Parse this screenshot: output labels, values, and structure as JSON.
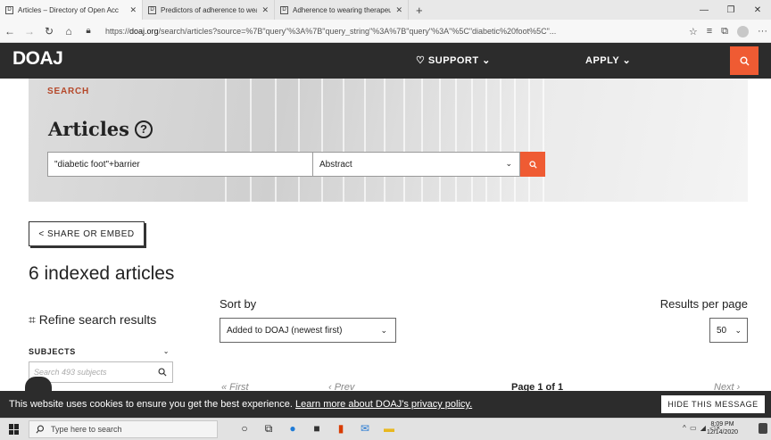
{
  "browser": {
    "tabs": [
      {
        "favicon": "D",
        "title": "Articles – Directory of Open Acc",
        "active": true
      },
      {
        "favicon": "D",
        "title": "Predictors of adherence to wea",
        "active": false
      },
      {
        "favicon": "D",
        "title": "Adherence to wearing therapeu",
        "active": false
      }
    ],
    "new_tab_label": "+",
    "url_prefix": "https://",
    "url_host": "doaj.org",
    "url_rest": "/search/articles?source=%7B\"query\"%3A%7B\"query_string\"%3A%7B\"query\"%3A\"%5C\"diabetic%20foot%5C\"...",
    "min_label": "—",
    "max_label": "❐",
    "close_label": "✕"
  },
  "header": {
    "logo": "DOAJ",
    "support_label": "♡ SUPPORT ⌄",
    "apply_label": "APPLY ⌄"
  },
  "hero": {
    "label": "SEARCH",
    "title": "Articles",
    "help_glyph": "?",
    "query": "\"diabetic foot\"+barrier",
    "field": "Abstract",
    "field_chevron": "⌄"
  },
  "share_label": "< SHARE OR EMBED",
  "results_count": "6 indexed articles",
  "refine_label": "⌗ Refine search results",
  "sort": {
    "label": "Sort by",
    "value": "Added to DOAJ (newest first)",
    "chevron": "⌄"
  },
  "rpp": {
    "label": "Results per page",
    "value": "50",
    "chevron": "⌄"
  },
  "subjects": {
    "label": "SUBJECTS",
    "chevron": "⌄",
    "placeholder": "Search 493 subjects"
  },
  "pager": {
    "first": "« First",
    "prev": "‹ Prev",
    "page": "Page 1 of 1",
    "next": "Next ›"
  },
  "cookie": {
    "text": "This website uses cookies to ensure you get the best experience. ",
    "link": "Learn more about DOAJ's privacy policy.",
    "hide_label": "HIDE THIS MESSAGE"
  },
  "taskbar": {
    "search_placeholder": "Type here to search",
    "tray": "^ ▭ ◢ ◁×",
    "time": "8:09 PM",
    "date": "12/14/2020"
  },
  "colors": {
    "accent": "#ef5b33",
    "header_bg": "#2c2c2c"
  }
}
